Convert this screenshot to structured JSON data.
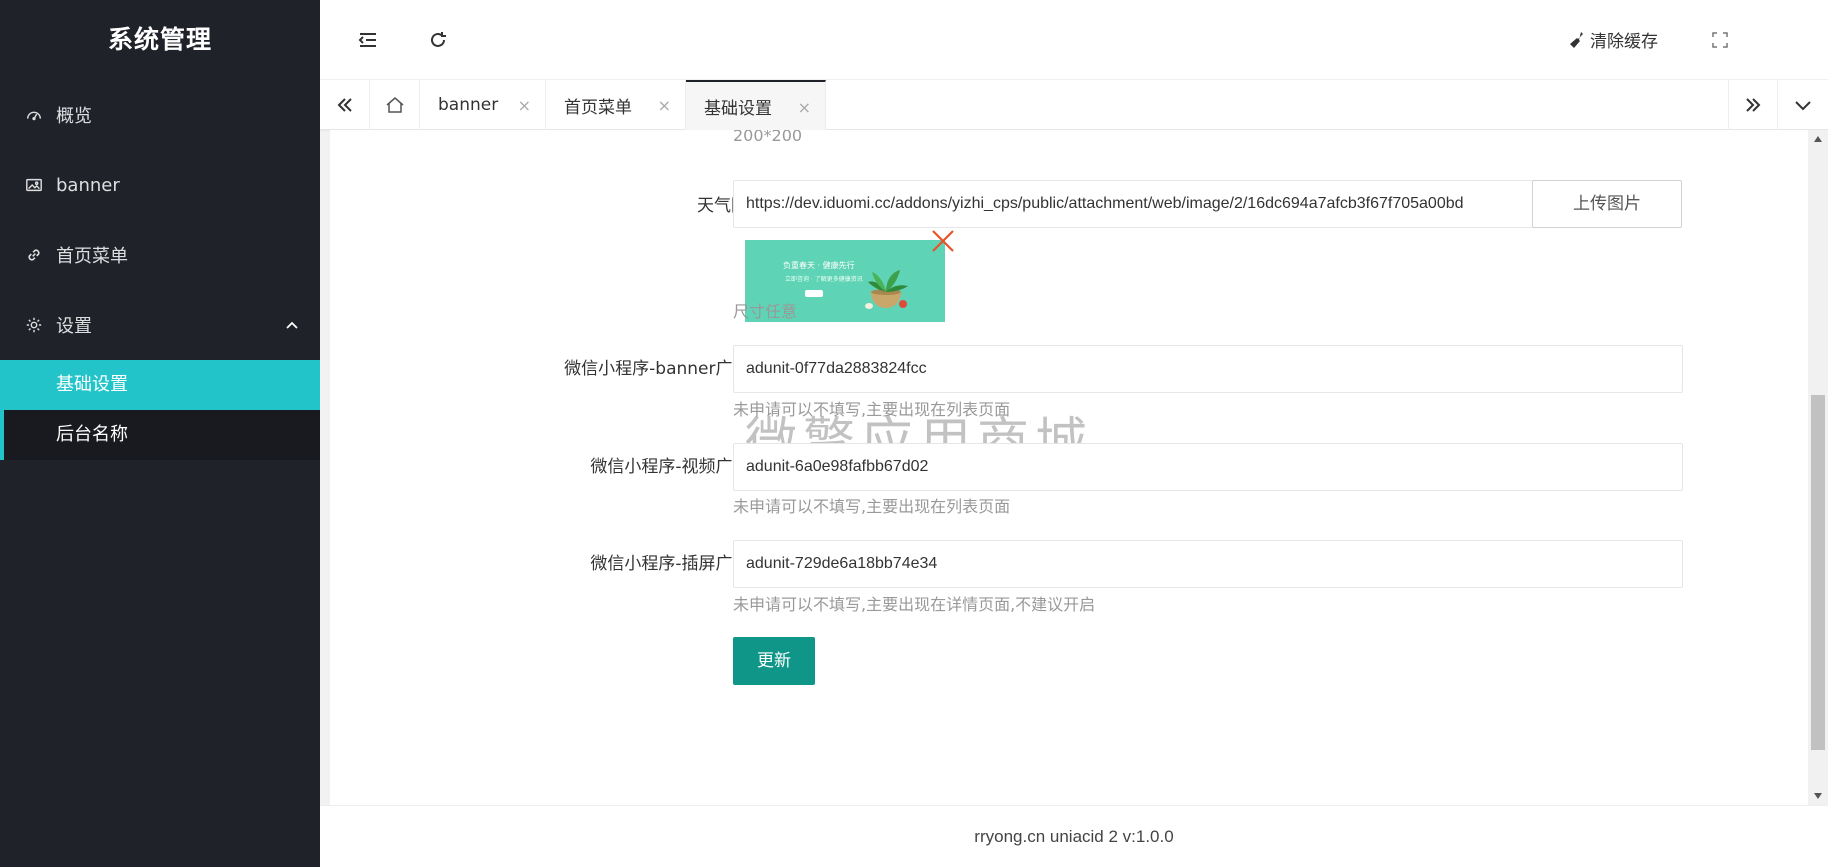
{
  "app": {
    "title": "系统管理"
  },
  "sidebar": {
    "items": [
      {
        "label": "概览",
        "icon": "dashboard-icon"
      },
      {
        "label": "banner",
        "icon": "image-icon"
      },
      {
        "label": "首页菜单",
        "icon": "link-icon"
      },
      {
        "label": "设置",
        "icon": "gear-icon",
        "expanded": true
      }
    ],
    "subitems": [
      {
        "label": "基础设置",
        "active": true
      },
      {
        "label": "后台名称",
        "active": false
      }
    ]
  },
  "header": {
    "clear_cache": "清除缓存"
  },
  "tabs": [
    {
      "label": "banner",
      "close": "×"
    },
    {
      "label": "首页菜单",
      "close": "×"
    },
    {
      "label": "基础设置",
      "close": "×",
      "active": true
    }
  ],
  "form": {
    "top_hint": "200*200",
    "weather_image": {
      "label": "天气图片",
      "value": "https://dev.iduomi.cc/addons/yizhi_cps/public/attachment/web/image/2/16dc694a7afcb3f67f705a00bd",
      "upload_label": "上传图片",
      "hint": "尺寸任意",
      "thumb_title": "负重春天 · 健康先行",
      "thumb_sub": "立即咨询 · 了解更多健康资讯"
    },
    "banner_ad": {
      "label": "微信小程序-banner广告id",
      "value": "adunit-0f77da2883824fcc",
      "hint": "未申请可以不填写,主要出现在列表页面"
    },
    "video_ad": {
      "label": "微信小程序-视频广告id",
      "value": "adunit-6a0e98fafbb67d02",
      "hint": "未申请可以不填写,主要出现在列表页面"
    },
    "interstitial_ad": {
      "label": "微信小程序-插屏广告id",
      "value": "adunit-729de6a18bb74e34",
      "hint": "未申请可以不填写,主要出现在详情页面,不建议开启"
    },
    "submit_label": "更新"
  },
  "watermark": "微擎应用商城",
  "footer": {
    "text": "rryong.cn uniacid 2   v:1.0.0"
  },
  "colors": {
    "sidebar_bg": "#20222a",
    "active_teal": "#22c4c9",
    "button_green": "#0f9688",
    "delete_red": "#e8532a"
  }
}
